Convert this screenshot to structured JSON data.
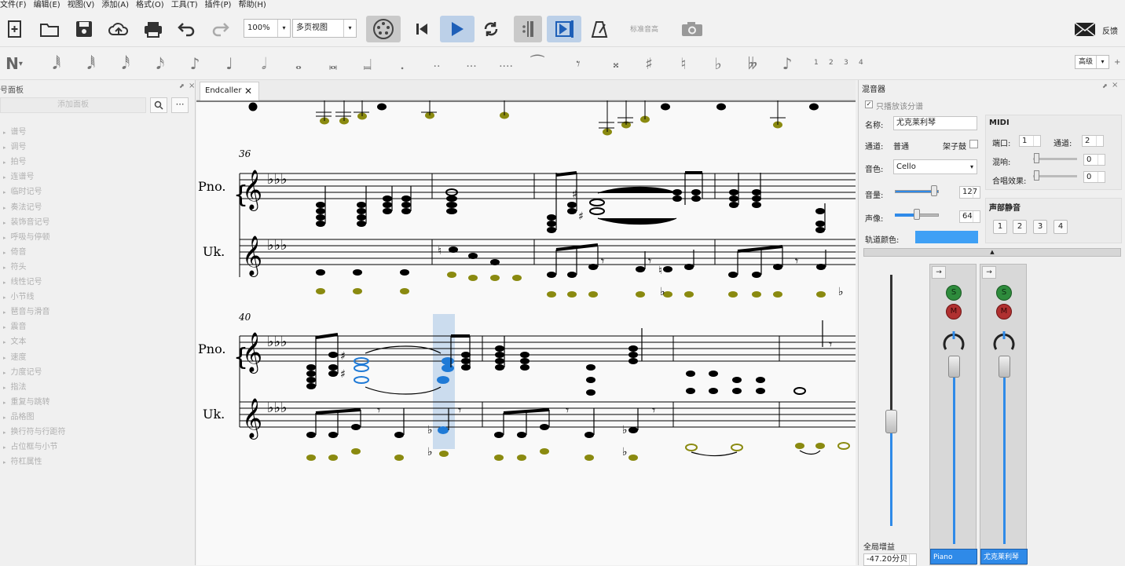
{
  "menubar": [
    "文件(F)",
    "编辑(E)",
    "视图(V)",
    "添加(A)",
    "格式(O)",
    "工具(T)",
    "插件(P)",
    "帮助(H)"
  ],
  "toolbar": {
    "zoom": "100%",
    "view_mode": "多页视图",
    "concert_pitch": "标准音高",
    "feedback": "反馈"
  },
  "notebar": {
    "advanced": "高级",
    "voices": [
      "1",
      "2",
      "3",
      "4"
    ],
    "plus": "+"
  },
  "palette": {
    "title": "号面板",
    "add_button": "添加面板",
    "items": [
      "谱号",
      "调号",
      "拍号",
      "连谱号",
      "临时记号",
      "奏法记号",
      "装饰音记号",
      "呼吸与停顿",
      "倚音",
      "符头",
      "线性记号",
      "小节线",
      "琶音与滑音",
      "震音",
      "文本",
      "速度",
      "力度记号",
      "指法",
      "重复与跳转",
      "品格图",
      "换行符与行距符",
      "占位框与小节",
      "符杠属性"
    ]
  },
  "score": {
    "tab_title": "Endcaller",
    "system1_measure": "36",
    "system2_measure": "40",
    "instr_piano": "Pno.",
    "instr_uke": "Uk."
  },
  "mixer": {
    "title": "混音器",
    "play_only_checkbox": "只播放该分谱",
    "name_label": "名称:",
    "name_value": "尤克莱利琴",
    "channel_label": "通道:",
    "channel_value": "普通",
    "drumset_label": "架子鼓",
    "sound_label": "音色:",
    "sound_value": "Cello",
    "volume_label": "音量:",
    "volume_value": "127",
    "pan_label": "声像:",
    "pan_value": "64",
    "track_color_label": "轨道颜色:",
    "track_color": "#3fa0f5",
    "midi_title": "MIDI",
    "port_label": "端口:",
    "port_value": "1",
    "midi_channel_label": "通道:",
    "midi_channel_value": "2",
    "reverb_label": "混响:",
    "reverb_value": "0",
    "chorus_label": "合唱效果:",
    "chorus_value": "0",
    "voice_mute_title": "声部静音",
    "voice_buttons": [
      "1",
      "2",
      "3",
      "4"
    ],
    "master_gain_label": "全局增益",
    "master_gain_value": "-47.20分贝",
    "solo": "S",
    "mute": "M",
    "channels": [
      "Piano",
      "尤克莱利琴"
    ]
  },
  "colors": {
    "accent": "#2f8ae8",
    "note_olive": "#8a8a10",
    "selection": "#b8d0ea",
    "selected_note": "#1f7ad6"
  }
}
